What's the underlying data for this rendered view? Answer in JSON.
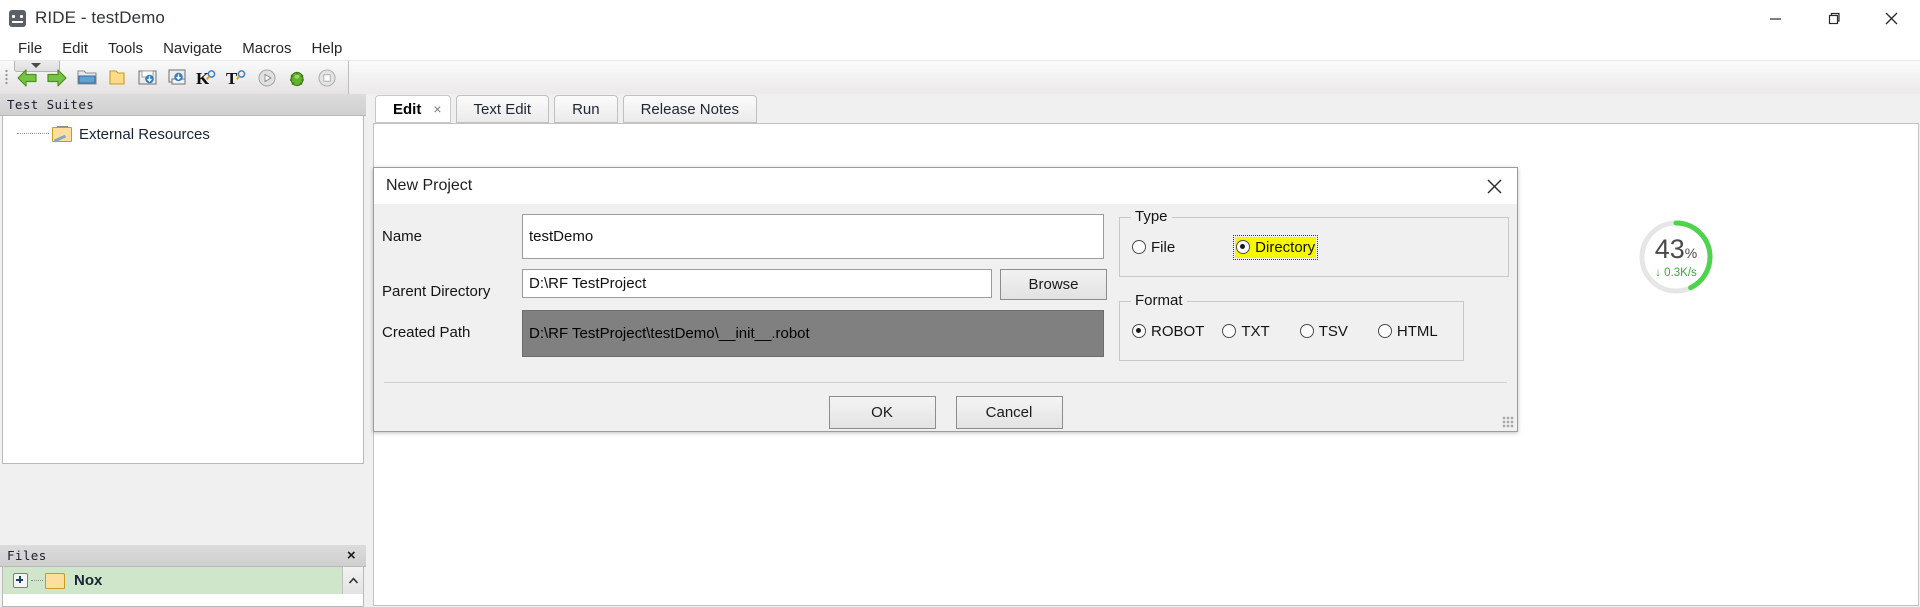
{
  "window": {
    "title": "RIDE - testDemo",
    "icon": "app-icon",
    "controls": {
      "minimize": "minimize-icon",
      "maximize": "maximize-icon",
      "close": "close-icon"
    }
  },
  "menubar": {
    "items": [
      {
        "label": "File"
      },
      {
        "label": "Edit"
      },
      {
        "label": "Tools"
      },
      {
        "label": "Navigate"
      },
      {
        "label": "Macros"
      },
      {
        "label": "Help"
      }
    ]
  },
  "toolbar": {
    "buttons": [
      {
        "name": "back-arrow-icon"
      },
      {
        "name": "forward-arrow-icon"
      },
      {
        "name": "open-folder-icon"
      },
      {
        "name": "new-folder-icon"
      },
      {
        "name": "save-icon"
      },
      {
        "name": "save-all-icon"
      },
      {
        "name": "search-keyword-icon",
        "glyph": "K"
      },
      {
        "name": "search-test-icon",
        "glyph": "T"
      },
      {
        "name": "run-icon"
      },
      {
        "name": "debug-icon"
      },
      {
        "name": "stop-icon"
      }
    ]
  },
  "left_panel": {
    "caption": "Test Suites",
    "tree": [
      {
        "label": "External Resources",
        "icon": "external-resources-icon"
      }
    ],
    "files": {
      "caption": "Files",
      "close": "×",
      "rows": [
        {
          "label": "Nox",
          "icon": "folder-icon",
          "expander": "+"
        }
      ]
    }
  },
  "editor": {
    "tabs": [
      {
        "label": "Edit",
        "active": true,
        "closable": true,
        "close": "×"
      },
      {
        "label": "Text Edit",
        "active": false,
        "closable": false
      },
      {
        "label": "Run",
        "active": false,
        "closable": false
      },
      {
        "label": "Release Notes",
        "active": false,
        "closable": false
      }
    ]
  },
  "dialog": {
    "title": "New Project",
    "close_icon": "close-icon",
    "fields": [
      {
        "label": "Name",
        "value": "testDemo",
        "name": "name-input"
      },
      {
        "label": "Parent Directory",
        "value": "D:\\RF TestProject",
        "name": "parent-directory-input"
      },
      {
        "label": "Created Path",
        "value": "D:\\RF TestProject\\testDemo\\__init__.robot",
        "name": "created-path-input",
        "readonly": true
      }
    ],
    "browse_label": "Browse",
    "type_group": {
      "legend": "Type",
      "options": [
        {
          "label": "File",
          "checked": false,
          "highlighted": false
        },
        {
          "label": "Directory",
          "checked": true,
          "highlighted": true
        }
      ]
    },
    "format_group": {
      "legend": "Format",
      "options": [
        {
          "label": "ROBOT",
          "checked": true
        },
        {
          "label": "TXT",
          "checked": false
        },
        {
          "label": "TSV",
          "checked": false
        },
        {
          "label": "HTML",
          "checked": false
        }
      ]
    },
    "actions": [
      {
        "label": "OK",
        "name": "ok-button"
      },
      {
        "label": "Cancel",
        "name": "cancel-button"
      }
    ]
  },
  "net_widget": {
    "percent": "43",
    "percent_unit": "%",
    "speed": "0.3K/s",
    "arrow": "↓",
    "ring_color": "#4dd44d",
    "progress": 43
  },
  "colors": {
    "highlight": "#f7f700",
    "selected_field_bg": "#808080",
    "tree_selection": "#cfe6cb"
  }
}
